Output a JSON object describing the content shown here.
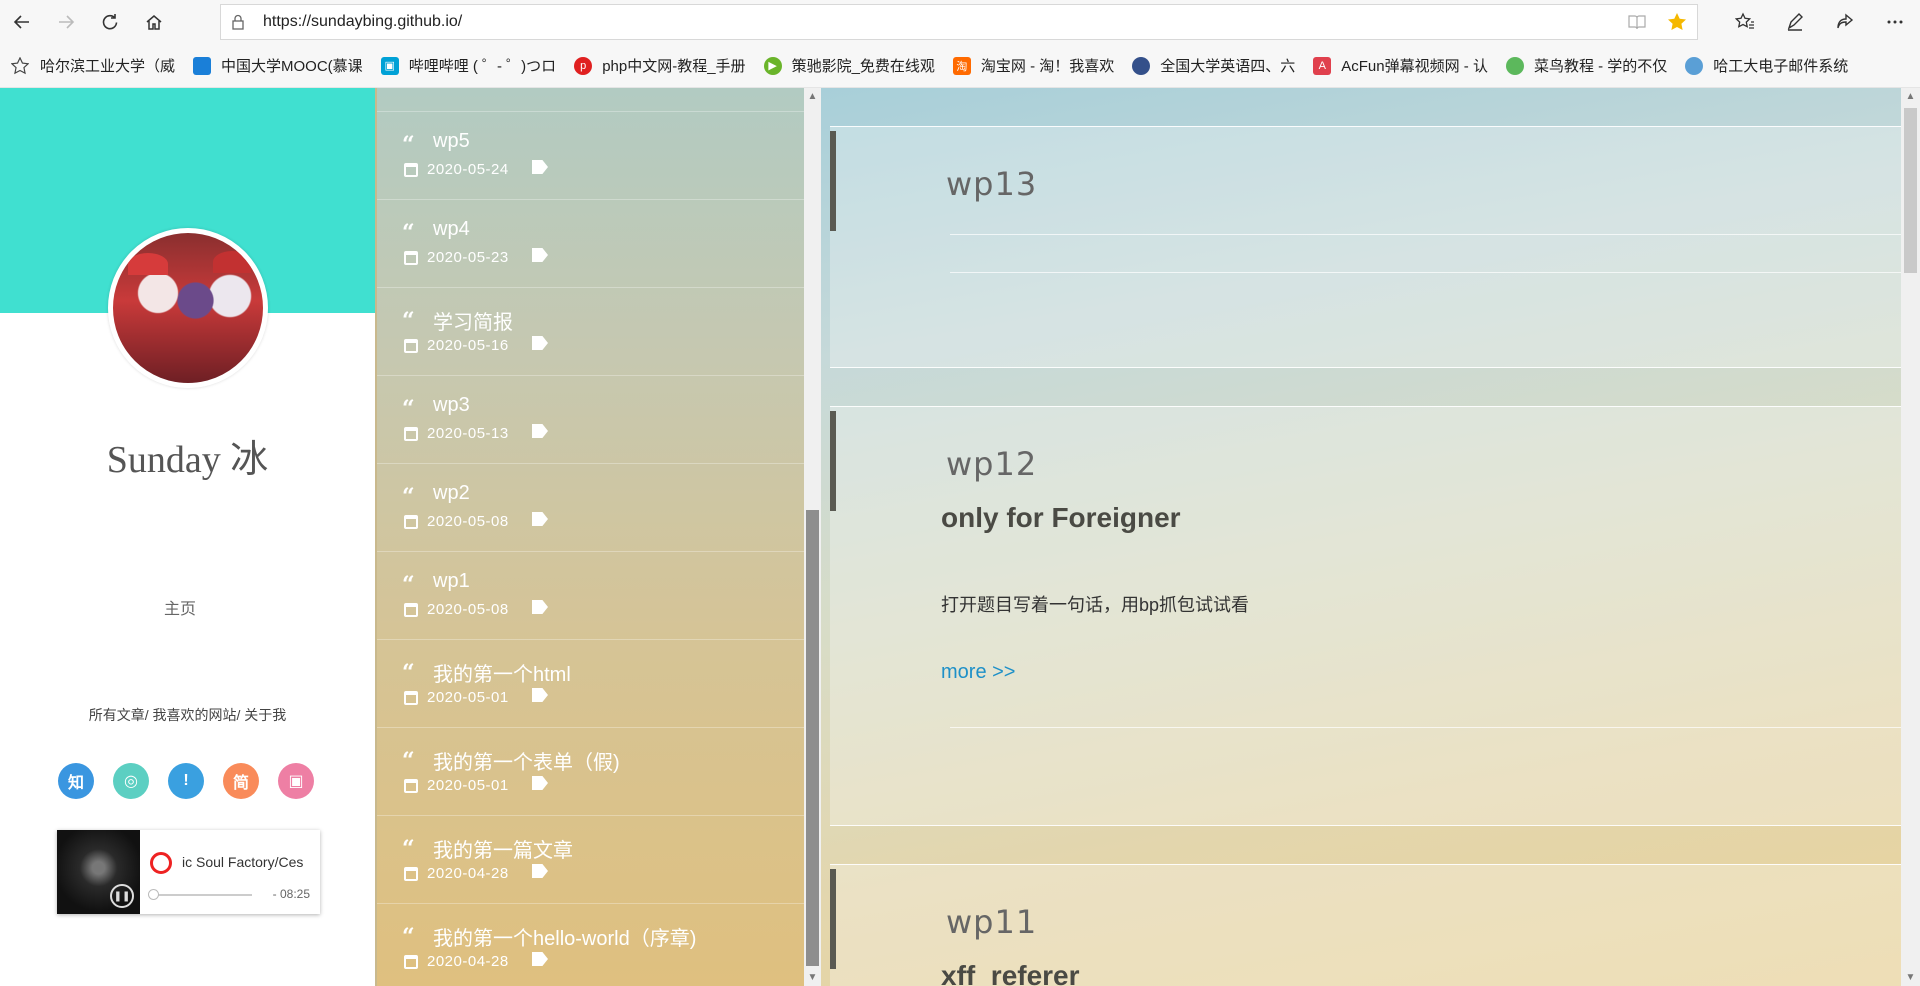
{
  "browser": {
    "url": "https://sundaybing.github.io/"
  },
  "bookmarks": [
    {
      "label": "哈尔滨工业大学（威",
      "icon": "none",
      "color": ""
    },
    {
      "label": "中国大学MOOC(慕课",
      "icon": "mooc-icon",
      "color": "#1a7fd8"
    },
    {
      "label": "哔哩哔哩 ( ゜- ゜)つロ",
      "icon": "bilibili-icon",
      "color": "#00a1d6"
    },
    {
      "label": "php中文网-教程_手册",
      "icon": "php-icon",
      "color": "#e02020"
    },
    {
      "label": "策驰影院_免费在线观",
      "icon": "play-icon",
      "color": "#6ab42a"
    },
    {
      "label": "淘宝网 - 淘！我喜欢",
      "icon": "taobao-icon",
      "color": "#ff6a00"
    },
    {
      "label": "全国大学英语四、六",
      "icon": "cet-icon",
      "color": "#34508a"
    },
    {
      "label": "AcFun弹幕视频网 - 认",
      "icon": "acfun-icon",
      "color": "#e0404d"
    },
    {
      "label": "菜鸟教程 - 学的不仅",
      "icon": "runoob-icon",
      "color": "#5cb85c"
    },
    {
      "label": "哈工大电子邮件系统",
      "icon": "mail-icon",
      "color": "#5a9fd6"
    }
  ],
  "profile": {
    "name": "Sunday 冰",
    "home": "主页",
    "links": "所有文章/ 我喜欢的网站/ 关于我",
    "socials": [
      {
        "glyph": "知",
        "icon": "zhihu-icon",
        "color": "#3a96e0"
      },
      {
        "glyph": "◎",
        "icon": "qq-icon",
        "color": "#5ccfc2"
      },
      {
        "glyph": "!",
        "icon": "weibo-icon",
        "color": "#3aa0e0"
      },
      {
        "glyph": "简",
        "icon": "jianshu-icon",
        "color": "#f98b5a"
      },
      {
        "glyph": "▣",
        "icon": "bilibili-icon",
        "color": "#ee7fa4"
      }
    ]
  },
  "player": {
    "title": "ic Soul Factory/Ces",
    "time": "- 08:25"
  },
  "posts": [
    {
      "title": "wp5",
      "date": "2020-05-24"
    },
    {
      "title": "wp4",
      "date": "2020-05-23"
    },
    {
      "title": "学习简报",
      "date": "2020-05-16"
    },
    {
      "title": "wp3",
      "date": "2020-05-13"
    },
    {
      "title": "wp2",
      "date": "2020-05-08"
    },
    {
      "title": "wp1",
      "date": "2020-05-08"
    },
    {
      "title": "我的第一个html",
      "date": "2020-05-01"
    },
    {
      "title": "我的第一个表单（假)",
      "date": "2020-05-01"
    },
    {
      "title": "我的第一篇文章",
      "date": "2020-04-28"
    },
    {
      "title": "我的第一个hello-world（序章)",
      "date": "2020-04-28"
    }
  ],
  "articles": [
    {
      "title": "wp13"
    },
    {
      "title": "wp12",
      "subtitle": "only for Foreigner",
      "body": "打开题目写着一句话，用bp抓包试试看",
      "more": "more >>"
    },
    {
      "title": "wp11",
      "subtitle": "xff_referer"
    }
  ]
}
